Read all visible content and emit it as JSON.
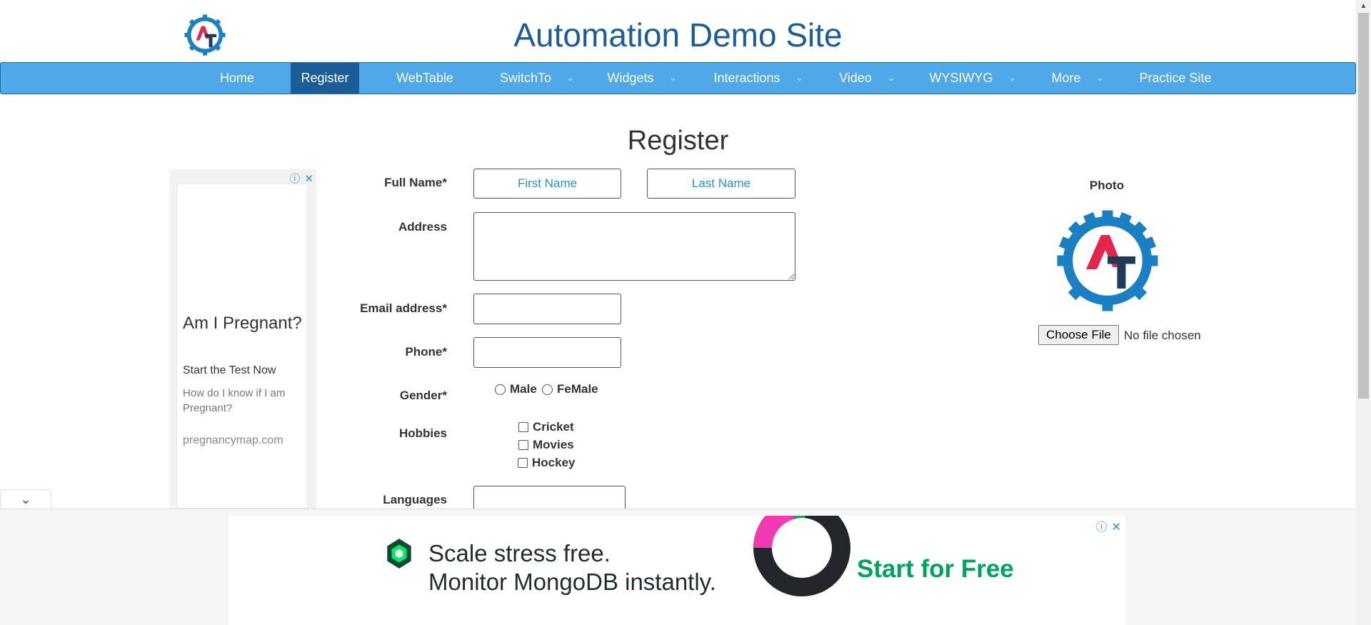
{
  "header": {
    "title": "Automation Demo Site"
  },
  "nav": {
    "items": [
      {
        "label": "Home"
      },
      {
        "label": "Register"
      },
      {
        "label": "WebTable"
      },
      {
        "label": "SwitchTo"
      },
      {
        "label": "Widgets"
      },
      {
        "label": "Interactions"
      },
      {
        "label": "Video"
      },
      {
        "label": "WYSIWYG"
      },
      {
        "label": "More"
      },
      {
        "label": "Practice Site"
      }
    ],
    "active": "Register",
    "chevron": "⌄",
    "bar_color": "#4fa8e8",
    "active_color": "#1c5c99"
  },
  "page": {
    "title": "Register"
  },
  "form": {
    "full_name_label": "Full Name*",
    "first_name_placeholder": "First Name",
    "last_name_placeholder": "Last Name",
    "address_label": "Address",
    "email_label": "Email address*",
    "phone_label": "Phone*",
    "gender_label": "Gender*",
    "gender_options": [
      "Male",
      "FeMale"
    ],
    "hobbies_label": "Hobbies",
    "hobbies": [
      "Cricket",
      "Movies",
      "Hockey"
    ],
    "languages_label": "Languages"
  },
  "photo": {
    "label": "Photo",
    "button": "Choose File",
    "status": "No file chosen"
  },
  "left_ad": {
    "heading": "Am I Pregnant?",
    "subheading": "Start the Test Now",
    "description": "How do I know if I am Pregnant?",
    "domain": "pregnancymap.com",
    "info_icon": "ⓘ",
    "close_icon": "✕"
  },
  "bottom_ad": {
    "line1": "Scale stress free.",
    "line2": "Monitor MongoDB instantly.",
    "cta": "Start for Free",
    "info_icon": "ⓘ",
    "close_icon": "✕",
    "collapse_icon": "⌄"
  },
  "colors": {
    "title": "#1c5c99",
    "accent": "#2b90c9",
    "logo_gear": "#1b7fc4",
    "logo_a": "#e2264d",
    "logo_t": "#1f3b57"
  }
}
